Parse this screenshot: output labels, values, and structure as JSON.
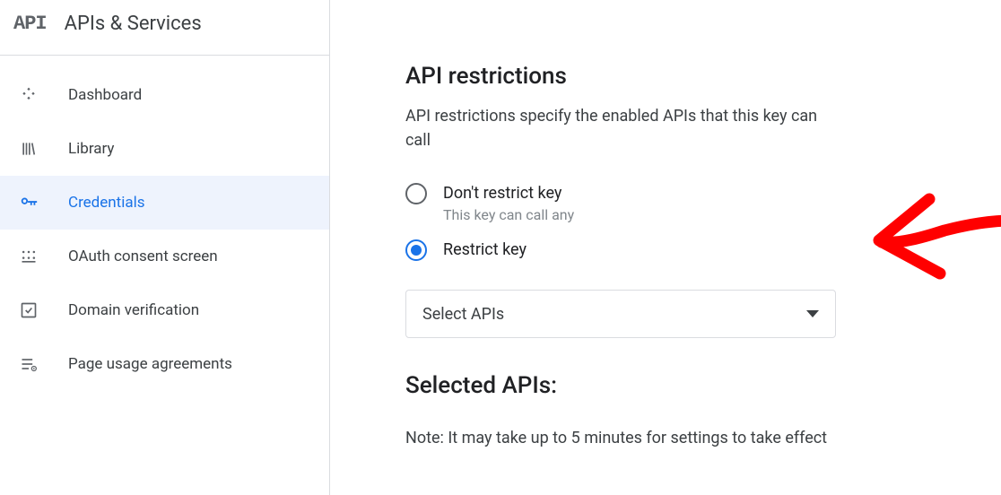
{
  "sidebar": {
    "title": "APIs & Services",
    "items": [
      {
        "label": "Dashboard"
      },
      {
        "label": "Library"
      },
      {
        "label": "Credentials"
      },
      {
        "label": "OAuth consent screen"
      },
      {
        "label": "Domain verification"
      },
      {
        "label": "Page usage agreements"
      }
    ],
    "selected_index": 2
  },
  "main": {
    "title": "API restrictions",
    "description": "API restrictions specify the enabled APIs that this key can call",
    "radio": {
      "options": [
        {
          "label": "Don't restrict key",
          "sub": "This key can call any"
        },
        {
          "label": "Restrict key",
          "sub": ""
        }
      ],
      "selected_index": 1
    },
    "select_placeholder": "Select APIs",
    "selected_title": "Selected APIs:",
    "note": "Note: It may take up to 5 minutes for settings to take effect"
  }
}
